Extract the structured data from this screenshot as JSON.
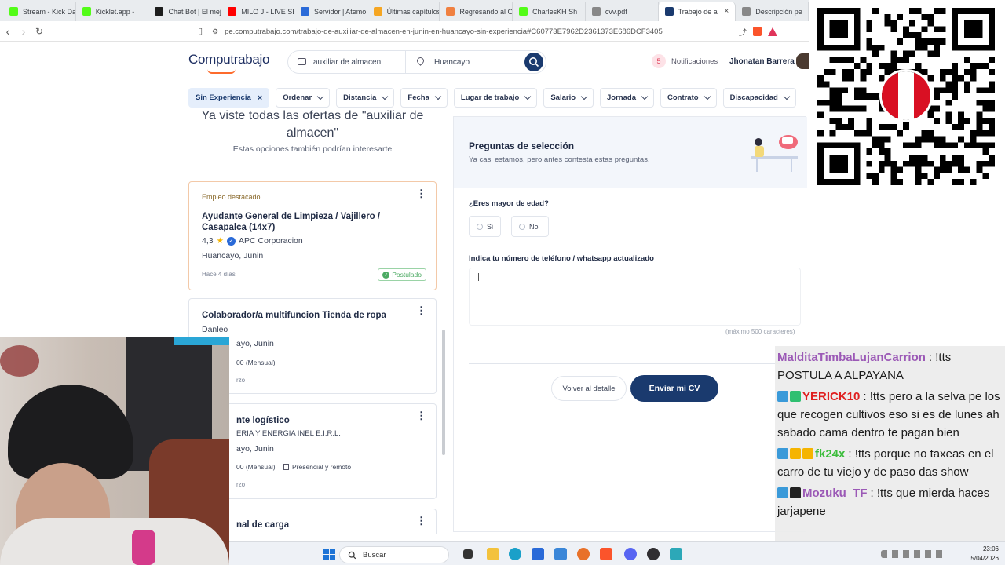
{
  "browser": {
    "tabs": [
      {
        "label": "Stream - Kick Da",
        "color": "#53fc18"
      },
      {
        "label": "Kicklet.app -",
        "color": "#53fc18"
      },
      {
        "label": "Chat Bot | El mej",
        "color": "#1d1d1d"
      },
      {
        "label": "MILO J - LIVE SE",
        "color": "#ff0000"
      },
      {
        "label": "Servidor | Atemo",
        "color": "#2a6ad8"
      },
      {
        "label": "Últimas capítulos",
        "color": "#f5a623"
      },
      {
        "label": "Regresando al O",
        "color": "#f08040"
      },
      {
        "label": "CharlesKH Sh",
        "color": "#53fc18"
      },
      {
        "label": "cvv.pdf",
        "color": "#888888"
      },
      {
        "label": "Trabajo de a",
        "color": "#1a3a6e"
      },
      {
        "label": "Descripción pe",
        "color": "#888888"
      }
    ],
    "url": "pe.computrabajo.com/trabajo-de-auxiliar-de-almacen-en-junin-en-huancayo-sin-experiencia#C60773E7962D2361373E686DCF3405"
  },
  "site": {
    "logo": "Computrabajo",
    "search_query": "auxiliar de almacen",
    "search_location": "Huancayo",
    "notifications_count": "5",
    "notifications_label": "Notificaciones",
    "user_name": "Jhonatan Barrera"
  },
  "filters": [
    {
      "label": "Sin Experiencia",
      "selected": true
    },
    {
      "label": "Ordenar"
    },
    {
      "label": "Distancia"
    },
    {
      "label": "Fecha"
    },
    {
      "label": "Lugar de trabajo"
    },
    {
      "label": "Salario"
    },
    {
      "label": "Jornada"
    },
    {
      "label": "Contrato"
    },
    {
      "label": "Discapacidad"
    }
  ],
  "left": {
    "seen_line1": "Ya viste todas las ofertas de \"auxiliar de",
    "seen_line2": "almacen\"",
    "also_interesting": "Estas opciones también podrían interesarte",
    "cards": {
      "c1": {
        "badge": "Empleo destacado",
        "title": "Ayudante General de Limpieza / Vajillero / Casapalca (14x7)",
        "rating": "4,3",
        "company": "APC Corporacion",
        "location": "Huancayo, Junin",
        "time": "Hace 4 días",
        "status": "Postulado"
      },
      "c2": {
        "title": "Colaborador/a multifuncion Tienda de ropa",
        "company": "Danleo",
        "location": "ayo, Junin",
        "salary": "00 (Mensual)",
        "extra": "rzo"
      },
      "c3": {
        "title": "nte logístico",
        "company": "ERIA Y ENERGIA INEL E.I.R.L.",
        "location": "ayo, Junin",
        "salary": "00 (Mensual)",
        "mode": "Presencial y remoto",
        "extra": "rzo"
      },
      "c4": {
        "title": "nal de carga"
      }
    }
  },
  "panel": {
    "title": "Preguntas de selección",
    "subtitle": "Ya casi estamos, pero antes contesta estas preguntas.",
    "q1": "¿Eres mayor de edad?",
    "opt_yes": "Si",
    "opt_no": "No",
    "q2": "Indica tu número de teléfono / whatsapp actualizado",
    "max_hint": "(máximo 500 caracteres)",
    "back_button": "Volver al detalle",
    "send_button": "Enviar mi CV"
  },
  "chat": {
    "messages": [
      {
        "user": "MalditaTimbaLujanCarrion",
        "color": "#9b59b6",
        "text": ": !tts POSTULA A ALPAYANA",
        "icons": []
      },
      {
        "user": "YERICK10",
        "color": "#e02020",
        "text": ": !tts pero a la selva pe los que recogen cultivos eso si es de lunes ah sabado cama dentro te pagan bien",
        "icons": [
          "#3a9ad9",
          "#2fbf71"
        ]
      },
      {
        "user": "fk24x",
        "color": "#3cbd3c",
        "text": ": !tts porque no taxeas en el carro de tu viejo y de paso das show",
        "icons": [
          "#3a9ad9",
          "#f5b400",
          "#f5b400"
        ]
      },
      {
        "user": "Mozuku_TF",
        "color": "#9b59b6",
        "text": ": !tts que mierda haces jarjapene",
        "icons": [
          "#3a9ad9",
          "#222222"
        ]
      }
    ]
  },
  "taskbar": {
    "search_label": "Buscar",
    "time": "23:06",
    "date": "5/04/2026"
  },
  "colors": {
    "brand": "#1a3a6e",
    "accent": "#fd6b2c",
    "chip_selected": "#e5eefb"
  }
}
